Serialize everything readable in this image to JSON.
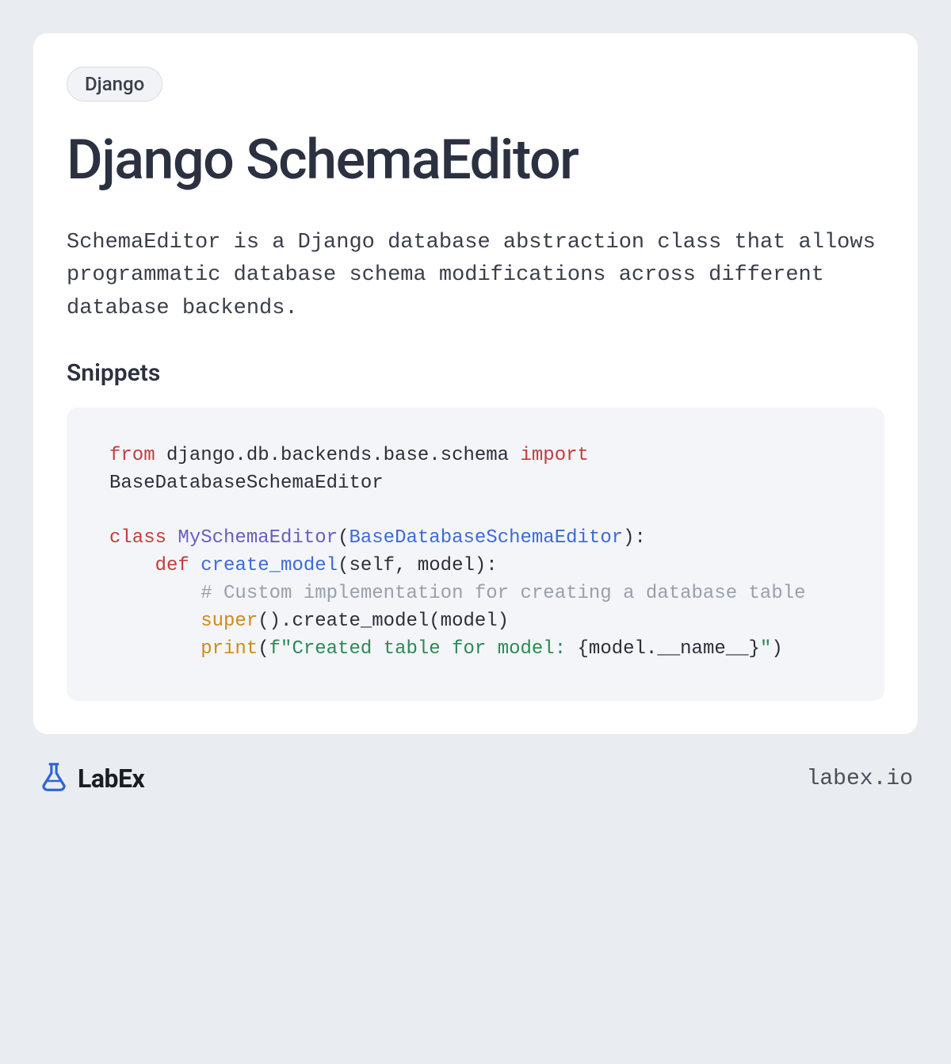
{
  "tag": "Django",
  "title": "Django SchemaEditor",
  "description": "SchemaEditor is a Django database abstraction class that allows programmatic database schema modifications across different database backends.",
  "snippets_heading": "Snippets",
  "code": {
    "lines": [
      [
        {
          "t": "from",
          "c": "kw"
        },
        {
          "t": " django.db.backends.base.schema ",
          "c": ""
        },
        {
          "t": "import",
          "c": "kw"
        },
        {
          "t": " BaseDatabaseSchemaEditor",
          "c": ""
        }
      ],
      [],
      [
        {
          "t": "class",
          "c": "kw"
        },
        {
          "t": " ",
          "c": ""
        },
        {
          "t": "MySchemaEditor",
          "c": "cls"
        },
        {
          "t": "(",
          "c": ""
        },
        {
          "t": "BaseDatabaseSchemaEditor",
          "c": "type"
        },
        {
          "t": "):",
          "c": ""
        }
      ],
      [
        {
          "t": "    ",
          "c": ""
        },
        {
          "t": "def",
          "c": "kw"
        },
        {
          "t": " ",
          "c": ""
        },
        {
          "t": "create_model",
          "c": "fn"
        },
        {
          "t": "(self, model):",
          "c": ""
        }
      ],
      [
        {
          "t": "        ",
          "c": ""
        },
        {
          "t": "# Custom implementation for creating a database table",
          "c": "comment"
        }
      ],
      [
        {
          "t": "        ",
          "c": ""
        },
        {
          "t": "super",
          "c": "builtin"
        },
        {
          "t": "().create_model(model)",
          "c": ""
        }
      ],
      [
        {
          "t": "        ",
          "c": ""
        },
        {
          "t": "print",
          "c": "builtin"
        },
        {
          "t": "(",
          "c": ""
        },
        {
          "t": "f\"Created table for model: ",
          "c": "str"
        },
        {
          "t": "{model.__name__}",
          "c": ""
        },
        {
          "t": "\"",
          "c": "str"
        },
        {
          "t": ")",
          "c": ""
        }
      ]
    ]
  },
  "footer": {
    "brand": "LabEx",
    "site": "labex.io"
  }
}
